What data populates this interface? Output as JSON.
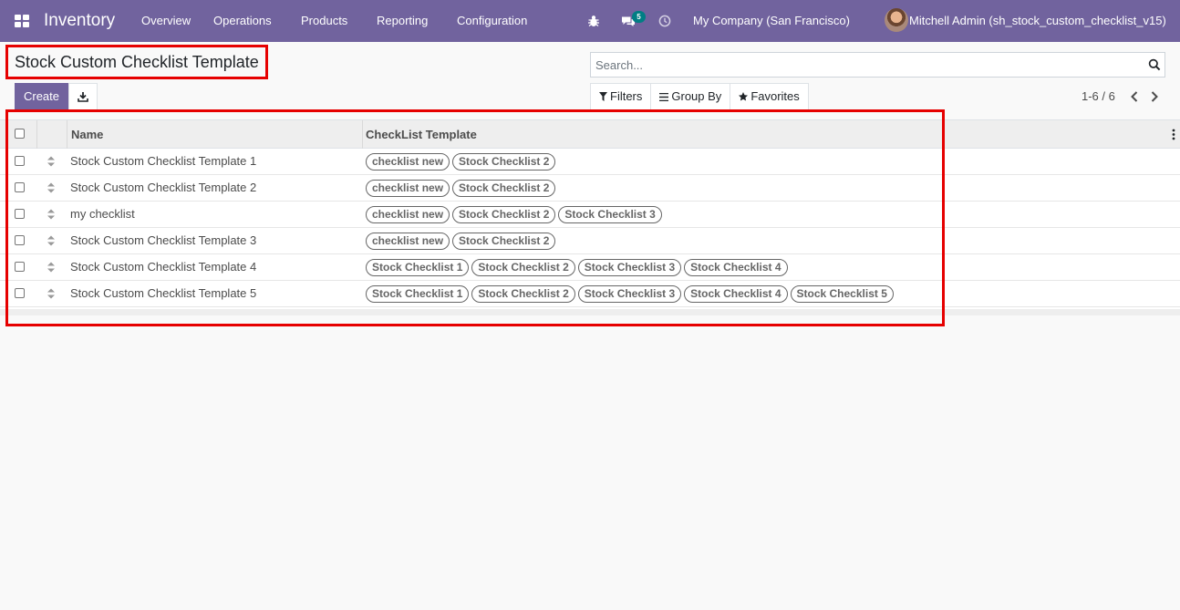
{
  "navbar": {
    "app_name": "Inventory",
    "menu": [
      "Overview",
      "Operations",
      "Products",
      "Reporting",
      "Configuration"
    ],
    "messages_count": "5",
    "company": "My Company (San Francisco)",
    "user": "Mitchell Admin (sh_stock_custom_checklist_v15)",
    "icons": [
      "apps-icon",
      "bug-icon",
      "chat-icon",
      "clock-icon"
    ],
    "bg_color": "#71639e"
  },
  "control_panel": {
    "title": "Stock Custom Checklist Template",
    "create_label": "Create",
    "search_placeholder": "Search...",
    "filters_label": "Filters",
    "group_by_label": "Group By",
    "favorites_label": "Favorites",
    "pager": "1-6 / 6"
  },
  "table": {
    "headers": {
      "name": "Name",
      "template": "CheckList Template"
    },
    "rows": [
      {
        "name": "Stock Custom Checklist Template 1",
        "tags": [
          "checklist new",
          "Stock Checklist 2"
        ]
      },
      {
        "name": "Stock Custom Checklist Template 2",
        "tags": [
          "checklist new",
          "Stock Checklist 2"
        ]
      },
      {
        "name": "my checklist",
        "tags": [
          "checklist new",
          "Stock Checklist 2",
          "Stock Checklist 3"
        ]
      },
      {
        "name": "Stock Custom Checklist Template 3",
        "tags": [
          "checklist new",
          "Stock Checklist 2"
        ]
      },
      {
        "name": "Stock Custom Checklist Template 4",
        "tags": [
          "Stock Checklist 1",
          "Stock Checklist 2",
          "Stock Checklist 3",
          "Stock Checklist 4"
        ]
      },
      {
        "name": "Stock Custom Checklist Template 5",
        "tags": [
          "Stock Checklist 1",
          "Stock Checklist 2",
          "Stock Checklist 3",
          "Stock Checklist 4",
          "Stock Checklist 5"
        ]
      }
    ]
  },
  "colors": {
    "primary": "#71639e",
    "highlight": "#e60000",
    "badge": "#017e84"
  }
}
